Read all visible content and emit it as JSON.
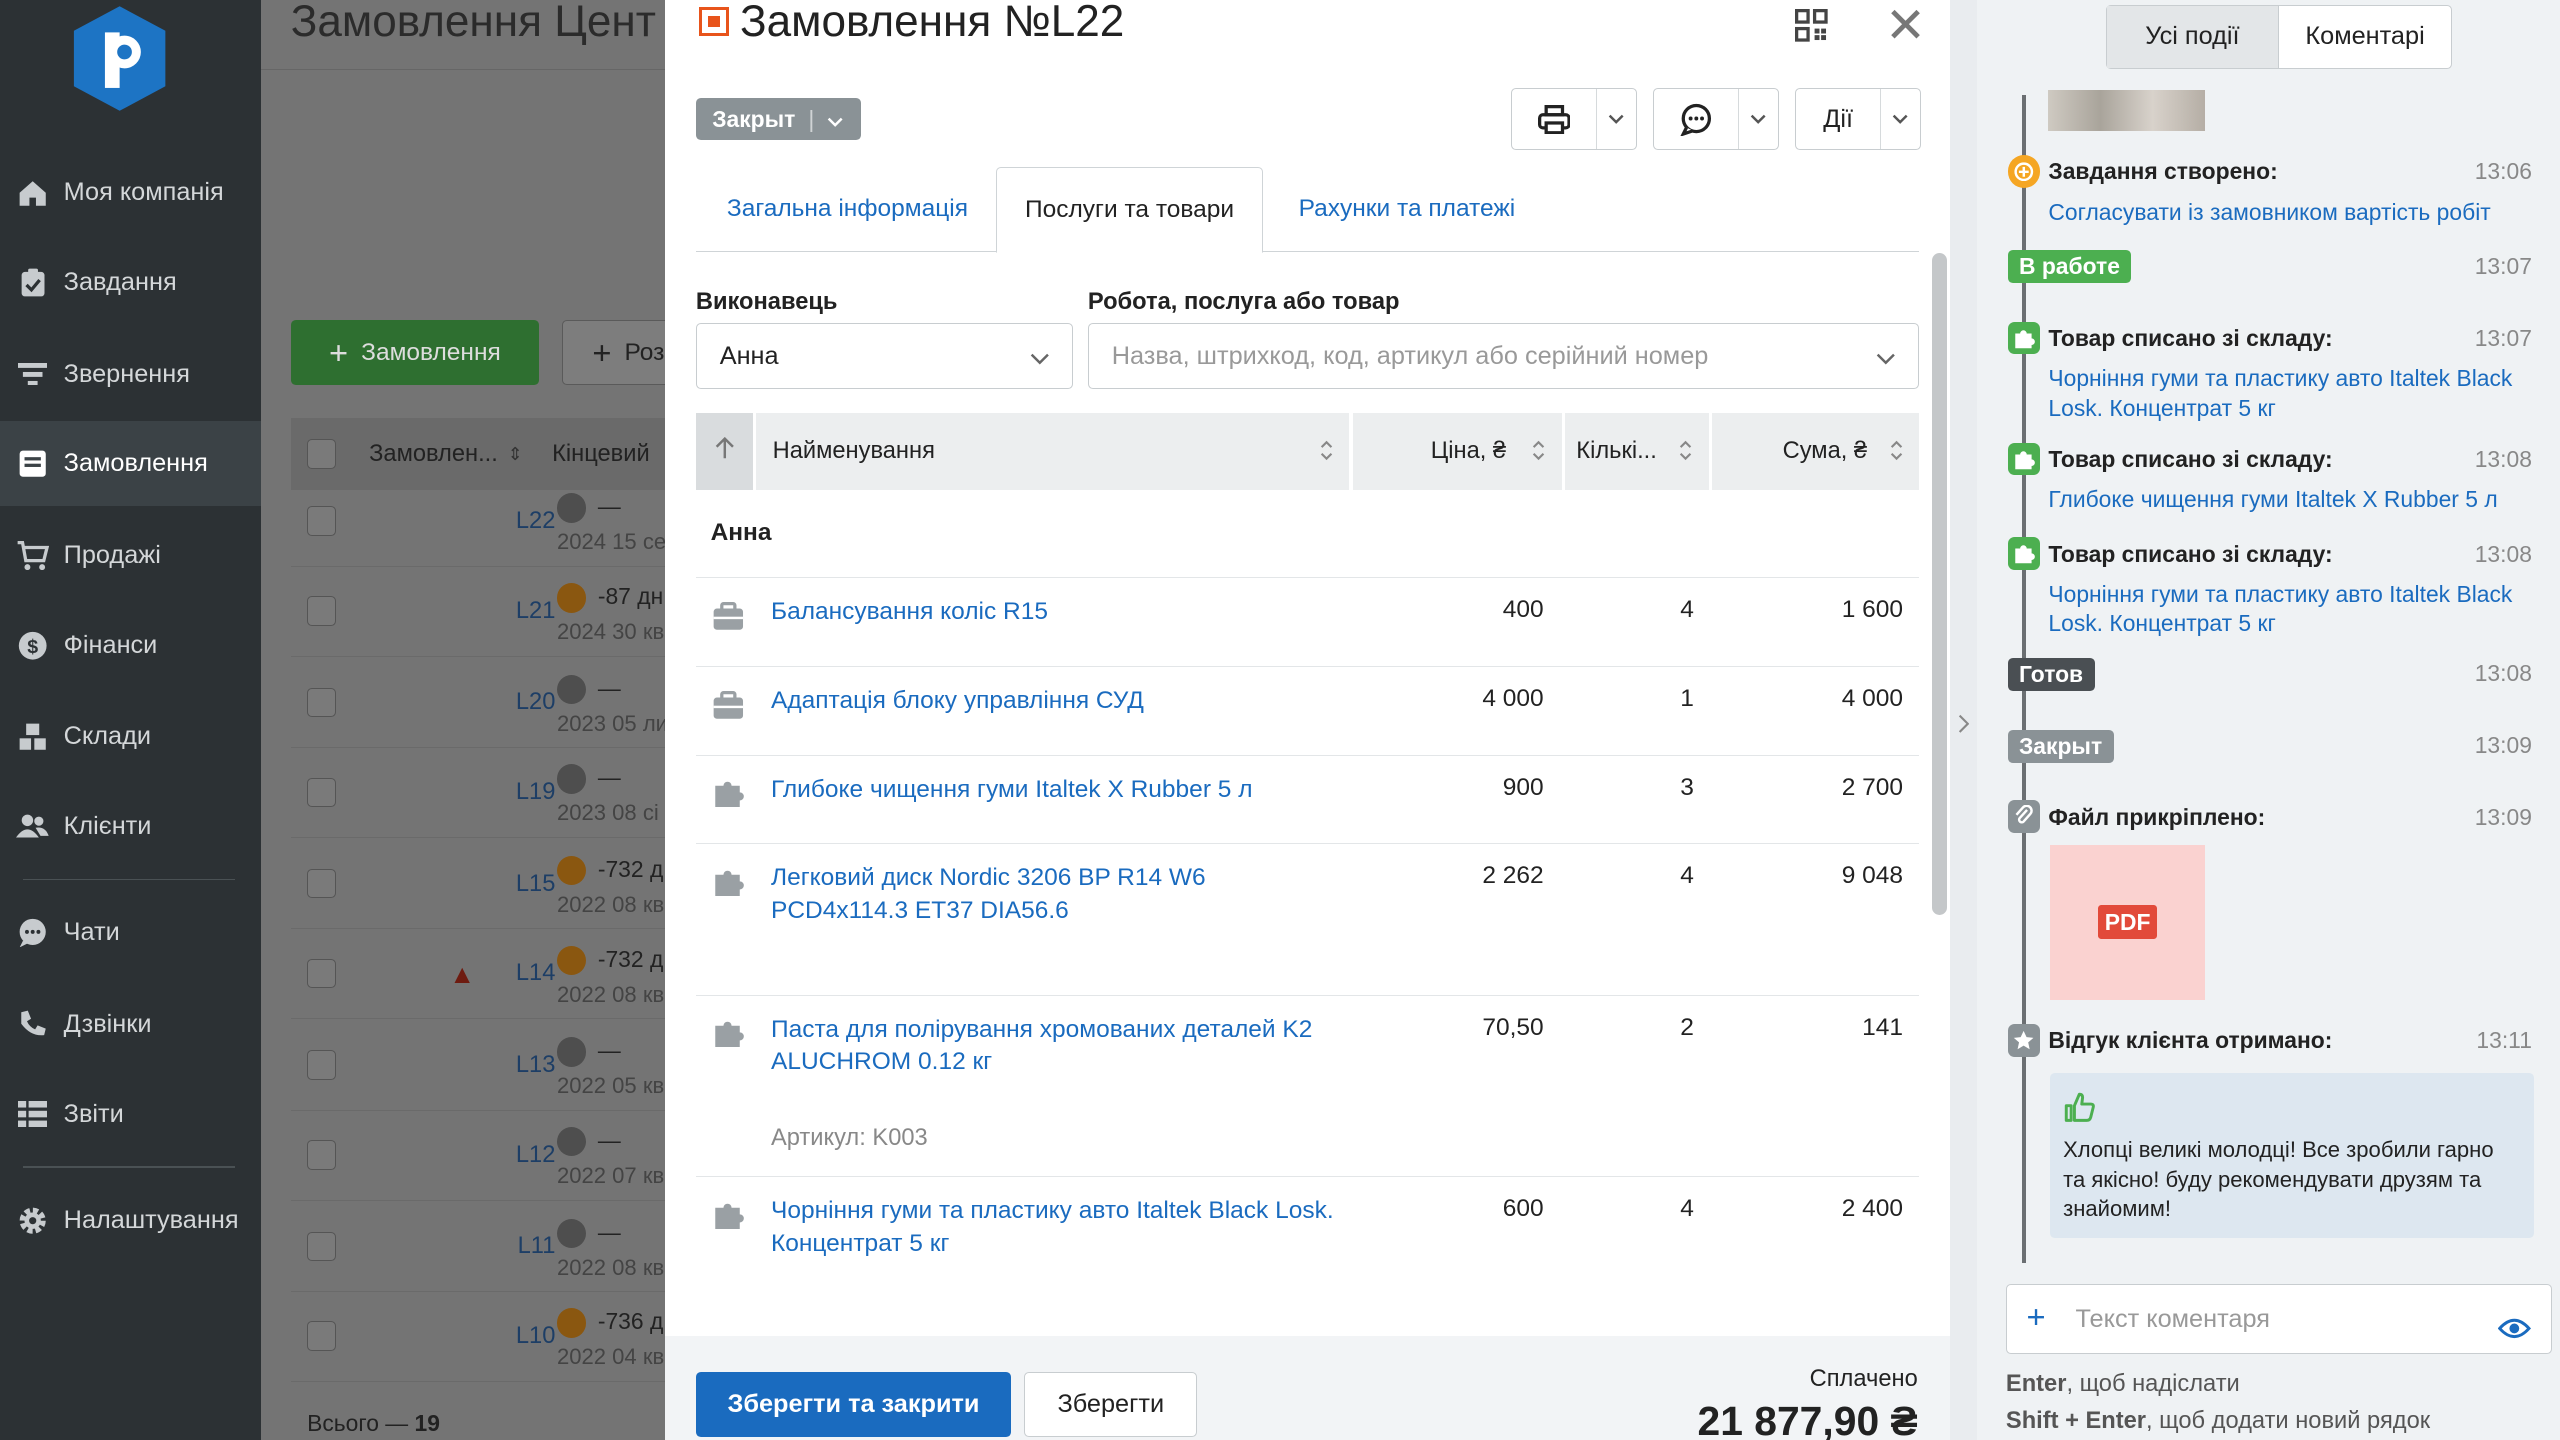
{
  "sidebar": {
    "items": [
      {
        "label": "Моя компанія",
        "icon": "home-icon"
      },
      {
        "label": "Завдання",
        "icon": "clipboard-check-icon"
      },
      {
        "label": "Звернення",
        "icon": "filter-lines-icon"
      },
      {
        "label": "Замовлення",
        "icon": "order-icon"
      },
      {
        "label": "Продажі",
        "icon": "cart-icon"
      },
      {
        "label": "Фінанси",
        "icon": "dollar-icon"
      },
      {
        "label": "Склади",
        "icon": "boxes-icon"
      },
      {
        "label": "Клієнти",
        "icon": "users-icon"
      },
      {
        "label": "Чати",
        "icon": "chat-icon"
      },
      {
        "label": "Дзвінки",
        "icon": "phone-icon"
      },
      {
        "label": "Звіти",
        "icon": "table-icon"
      },
      {
        "label": "Налаштування",
        "icon": "gear-icon"
      }
    ]
  },
  "background": {
    "title": "Замовлення Цент",
    "new_order_button": "Замовлення",
    "second_button": "Роз",
    "col_order": "Замовлен...",
    "col_deadline": "Кінцевий",
    "rows": [
      {
        "num": "L22",
        "status": "—",
        "date": "2024 15 се",
        "clock": "grey",
        "fire": false
      },
      {
        "num": "L21",
        "status": "-87 дн",
        "date": "2024 30 кв",
        "clock": "orange",
        "fire": false
      },
      {
        "num": "L20",
        "status": "—",
        "date": "2023 05 ли",
        "clock": "grey",
        "fire": false
      },
      {
        "num": "L19",
        "status": "—",
        "date": "2023 08 сі",
        "clock": "grey",
        "fire": false
      },
      {
        "num": "L15",
        "status": "-732 д",
        "date": "2022 08 кв",
        "clock": "orange",
        "fire": false
      },
      {
        "num": "L14",
        "status": "-732 д",
        "date": "2022 08 кв",
        "clock": "orange",
        "fire": true
      },
      {
        "num": "L13",
        "status": "—",
        "date": "2022 05 кв",
        "clock": "grey",
        "fire": false
      },
      {
        "num": "L12",
        "status": "—",
        "date": "2022 07 кв",
        "clock": "grey",
        "fire": false
      },
      {
        "num": "L11",
        "status": "—",
        "date": "2022 08 кв",
        "clock": "grey",
        "fire": false
      },
      {
        "num": "L10",
        "status": "-736 д",
        "date": "2022 04 кв",
        "clock": "orange",
        "fire": false
      }
    ],
    "total_label": "Всього —",
    "total_value": "19"
  },
  "modal": {
    "title": "Замовлення №L22",
    "status": "Закрыт",
    "actions_label": "Дії",
    "tabs": [
      "Загальна інформація",
      "Послуги та товари",
      "Рахунки та платежі"
    ],
    "executor_label": "Виконавець",
    "executor_value": "Анна",
    "product_label": "Робота, послуга або товар",
    "product_placeholder": "Назва, штрихкод, код, артикул або серійний номер",
    "columns": {
      "name": "Найменування",
      "price": "Ціна, ₴",
      "qty": "Кількі...",
      "sum": "Сума, ₴"
    },
    "group": "Анна",
    "items": [
      {
        "icon": "briefcase-icon",
        "name": "Балансування коліс R15",
        "price": "400",
        "qty": "4",
        "sum": "1 600"
      },
      {
        "icon": "briefcase-icon",
        "name": "Адаптація блоку управління СУД",
        "price": "4 000",
        "qty": "1",
        "sum": "4 000"
      },
      {
        "icon": "puzzle-icon",
        "name": "Глибоке чищення гуми Italtek X Rubber 5 л",
        "price": "900",
        "qty": "3",
        "sum": "2 700"
      },
      {
        "icon": "puzzle-icon",
        "name": "Легковий диск Nordic 3206 BP R14 W6 PCD4x114.3 ET37 DIA56.6",
        "price": "2 262",
        "qty": "4",
        "sum": "9 048"
      },
      {
        "icon": "puzzle-icon",
        "name": "Паста для полірування хромованих деталей K2 ALUCHROM 0.12 кг",
        "price": "70,50",
        "qty": "2",
        "sum": "141",
        "article": "Артикул: K003"
      },
      {
        "icon": "puzzle-icon",
        "name": "Чорніння гуми та пластику авто Italtek Black Losk. Концентрат 5 кг",
        "price": "600",
        "qty": "4",
        "sum": "2 400"
      }
    ],
    "save_close": "Зберегти та закрити",
    "save": "Зберегти",
    "paid_label": "Сплачено",
    "paid_value": "21 877,90 ₴"
  },
  "panel": {
    "seg_all": "Усі події",
    "seg_comments": "Коментарі",
    "events": [
      {
        "title": "Завдання створено:",
        "time": "13:06",
        "text": "Согласувати із замовником вартість робіт"
      },
      {
        "badge": "В работе",
        "time": "13:07"
      },
      {
        "title": "Товар списано зі складу:",
        "time": "13:07",
        "text": "Чорніння гуми та пластику авто Italtek Black Losk. Концентрат 5 кг"
      },
      {
        "title": "Товар списано зі складу:",
        "time": "13:08",
        "text": "Глибоке чищення гуми Italtek X Rubber 5 л"
      },
      {
        "title": "Товар списано зі складу:",
        "time": "13:08",
        "text": "Чорніння гуми та пластику авто Italtek Black Losk. Концентрат 5 кг"
      },
      {
        "badge": "Готов",
        "time": "13:08"
      },
      {
        "badge": "Закрыт",
        "time": "13:09"
      },
      {
        "title": "Файл прикріплено:",
        "time": "13:09",
        "file": "PDF"
      },
      {
        "title": "Відгук клієнта отримано:",
        "time": "13:11",
        "text": "Хлопці великі молодці! Все зробили гарно та якісно! буду рекомендувати друзям та знайомим!"
      }
    ],
    "comment_placeholder": "Текст коментаря",
    "hint1_key": "Enter",
    "hint1_text": ", щоб надіслати",
    "hint2_key": "Shift + Enter",
    "hint2_text": ", щоб додати новий рядок"
  },
  "colors": {
    "accent": "#1a6bbf",
    "sidebar": "#2c3134",
    "green": "#4caf50",
    "orange": "#f5a623",
    "brand_orange": "#e8541b"
  }
}
